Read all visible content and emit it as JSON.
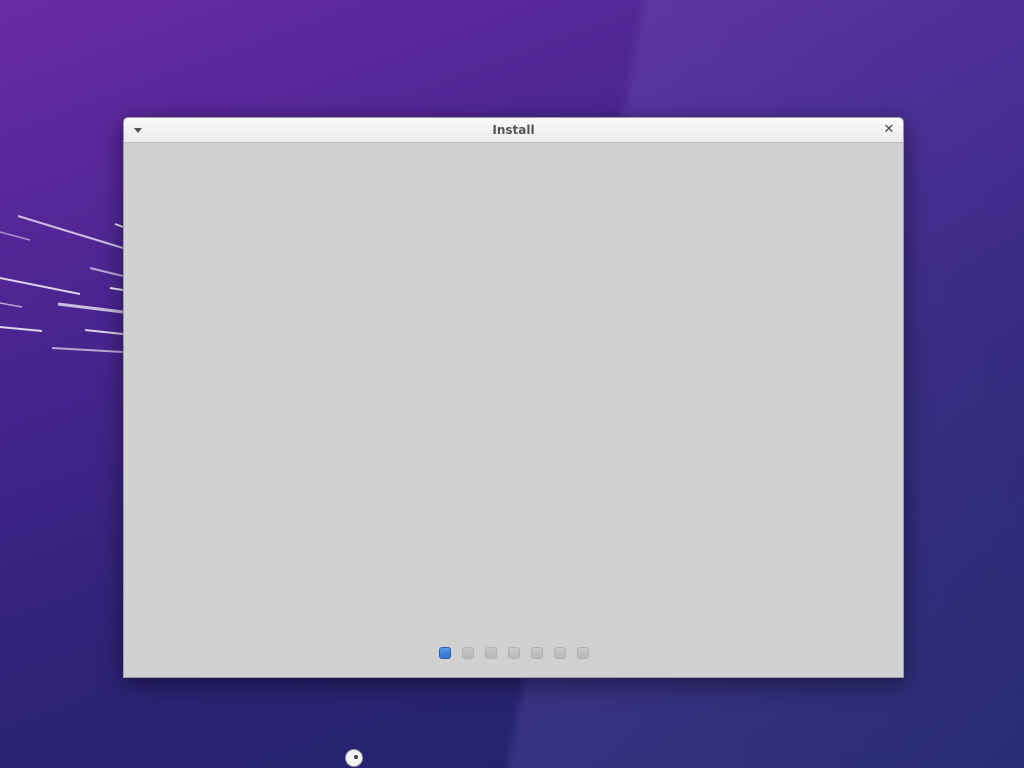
{
  "window": {
    "title": "Install",
    "menu_icon": "chevron-down-icon",
    "close_glyph": "✕"
  },
  "stepper": {
    "total_steps": 7,
    "current_step": 1,
    "active_color": "#3a7bd5",
    "inactive_color": "#bdbdbd"
  },
  "desktop": {
    "wallpaper_colors": [
      "#6a2aa6",
      "#2e2277",
      "#1f2468"
    ],
    "cursor_icon": "busy-cursor-icon"
  }
}
